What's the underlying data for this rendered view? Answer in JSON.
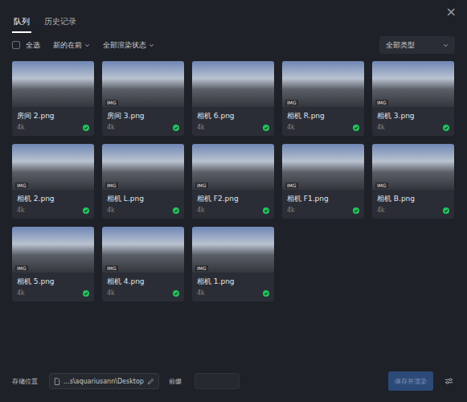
{
  "window": {
    "close": "×"
  },
  "tabs": [
    {
      "label": "队列",
      "selected": true
    },
    {
      "label": "历史记录",
      "selected": false
    }
  ],
  "toolbar": {
    "select_all": {
      "label": "全选",
      "checked": false
    },
    "sort": "新的在前",
    "status_filter": "全部渲染状态",
    "type_filter": "全部类型"
  },
  "items": [
    {
      "name": "房间 2.png",
      "resolution": "4k",
      "badge": "",
      "done": true
    },
    {
      "name": "房间 3.png",
      "resolution": "4k",
      "badge": "IMG",
      "done": true
    },
    {
      "name": "相机 6.png",
      "resolution": "4k",
      "badge": "",
      "done": true
    },
    {
      "name": "相机 R.png",
      "resolution": "4k",
      "badge": "IMG",
      "done": true
    },
    {
      "name": "相机 3.png",
      "resolution": "4k",
      "badge": "IMG",
      "done": true
    },
    {
      "name": "相机 2.png",
      "resolution": "4k",
      "badge": "IMG",
      "done": true
    },
    {
      "name": "相机 L.png",
      "resolution": "4k",
      "badge": "IMG",
      "done": true
    },
    {
      "name": "相机 F2.png",
      "resolution": "4k",
      "badge": "IMG",
      "done": true
    },
    {
      "name": "相机 F1.png",
      "resolution": "4k",
      "badge": "IMG",
      "done": true
    },
    {
      "name": "相机 B.png",
      "resolution": "4k",
      "badge": "IMG",
      "done": true
    },
    {
      "name": "相机 5.png",
      "resolution": "4k",
      "badge": "IMG",
      "done": true
    },
    {
      "name": "相机 4.png",
      "resolution": "4k",
      "badge": "IMG",
      "done": true
    },
    {
      "name": "相机 1.png",
      "resolution": "4k",
      "badge": "IMG",
      "done": true
    }
  ],
  "footer": {
    "storage_label": "存储位置",
    "path": "...s\\aquariusann\\Desktop",
    "prefix_label": "前缀",
    "prefix_value": "",
    "submit": {
      "label": "保存并渲染",
      "disabled": true
    }
  }
}
